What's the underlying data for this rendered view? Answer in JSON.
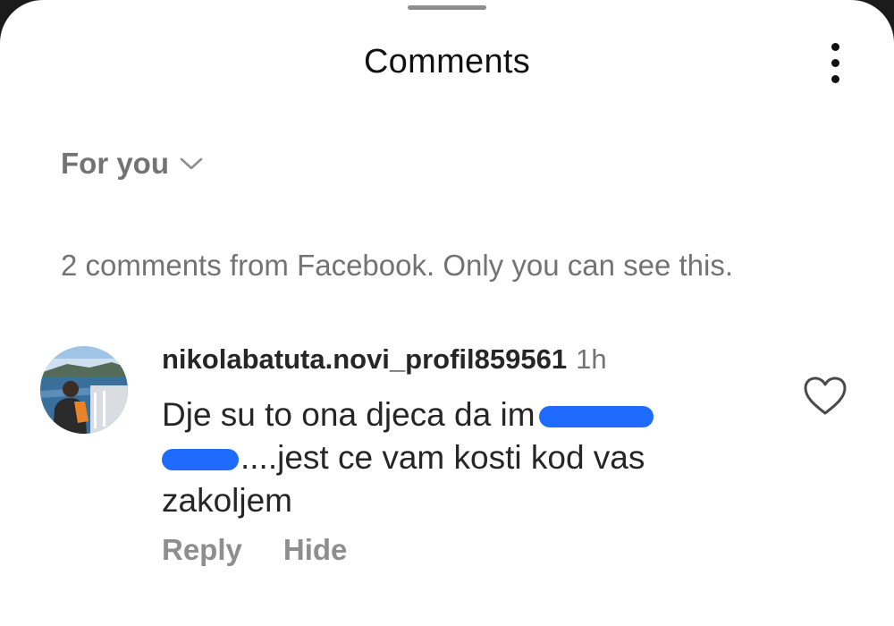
{
  "header": {
    "title": "Comments"
  },
  "filter": {
    "label": "For you"
  },
  "notice": "2 comments from Facebook. Only you can see this.",
  "comment": {
    "username": "nikolabatuta.novi_profil859561",
    "timestamp": "1h",
    "text_part1": "Dje su to ona djeca da im",
    "text_part2": "....jest ce vam kosti kod vas",
    "text_part3": "zakoljem",
    "reply_label": "Reply",
    "hide_label": "Hide"
  },
  "colors": {
    "text_primary": "#262626",
    "text_secondary": "#737373",
    "redaction": "#1f6bff"
  },
  "icons": {
    "more": "more-vertical-icon",
    "filter_dropdown": "chevron-down-icon",
    "like": "heart-outline-icon"
  }
}
